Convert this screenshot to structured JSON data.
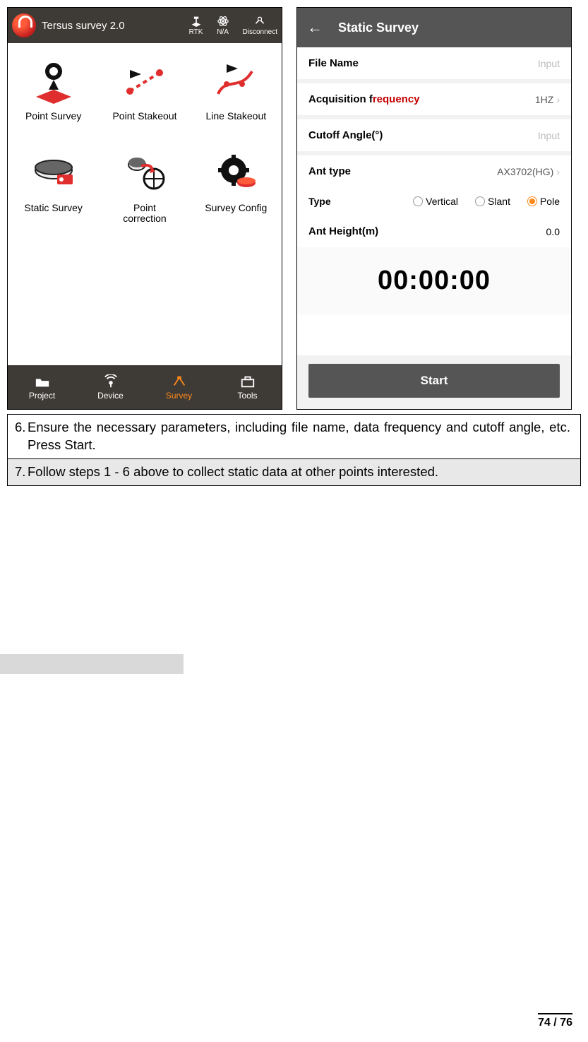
{
  "phone1": {
    "header": {
      "title": "Tersus survey 2.0",
      "status": [
        "RTK",
        "N/A",
        "Disconnect"
      ]
    },
    "tiles": [
      {
        "label": "Point Survey"
      },
      {
        "label": "Point Stakeout"
      },
      {
        "label": "Line Stakeout"
      },
      {
        "label": "Static Survey"
      },
      {
        "label": "Point\ncorrection"
      },
      {
        "label": "Survey Config"
      }
    ],
    "tabs": [
      {
        "label": "Project"
      },
      {
        "label": "Device"
      },
      {
        "label": "Survey",
        "active": true
      },
      {
        "label": "Tools"
      }
    ]
  },
  "phone2": {
    "header": {
      "title": "Static Survey"
    },
    "rows": {
      "file_name": {
        "label": "File Name",
        "value": "Input"
      },
      "acq_freq": {
        "label_a": "Acquisition f",
        "label_b": "requency",
        "value": "1HZ"
      },
      "cutoff": {
        "label": "Cutoff Angle(°)",
        "value": "Input"
      },
      "ant_type": {
        "label": "Ant type",
        "value": "AX3702(HG)"
      },
      "type": {
        "label": "Type",
        "options": [
          "Vertical",
          "Slant",
          "Pole"
        ],
        "selected": "Pole"
      },
      "ant_h": {
        "label": "Ant Height(m)",
        "value": "0.0"
      }
    },
    "timer": "00:00:00",
    "start": "Start"
  },
  "instructions": {
    "step6_num": "6.",
    "step6": "Ensure the necessary parameters, including file name, data frequency and cutoff angle, etc. Press Start.",
    "step7_num": "7.",
    "step7": "Follow steps 1 - 6 above to collect static data at other points interested."
  },
  "page_number": "74 / 76"
}
